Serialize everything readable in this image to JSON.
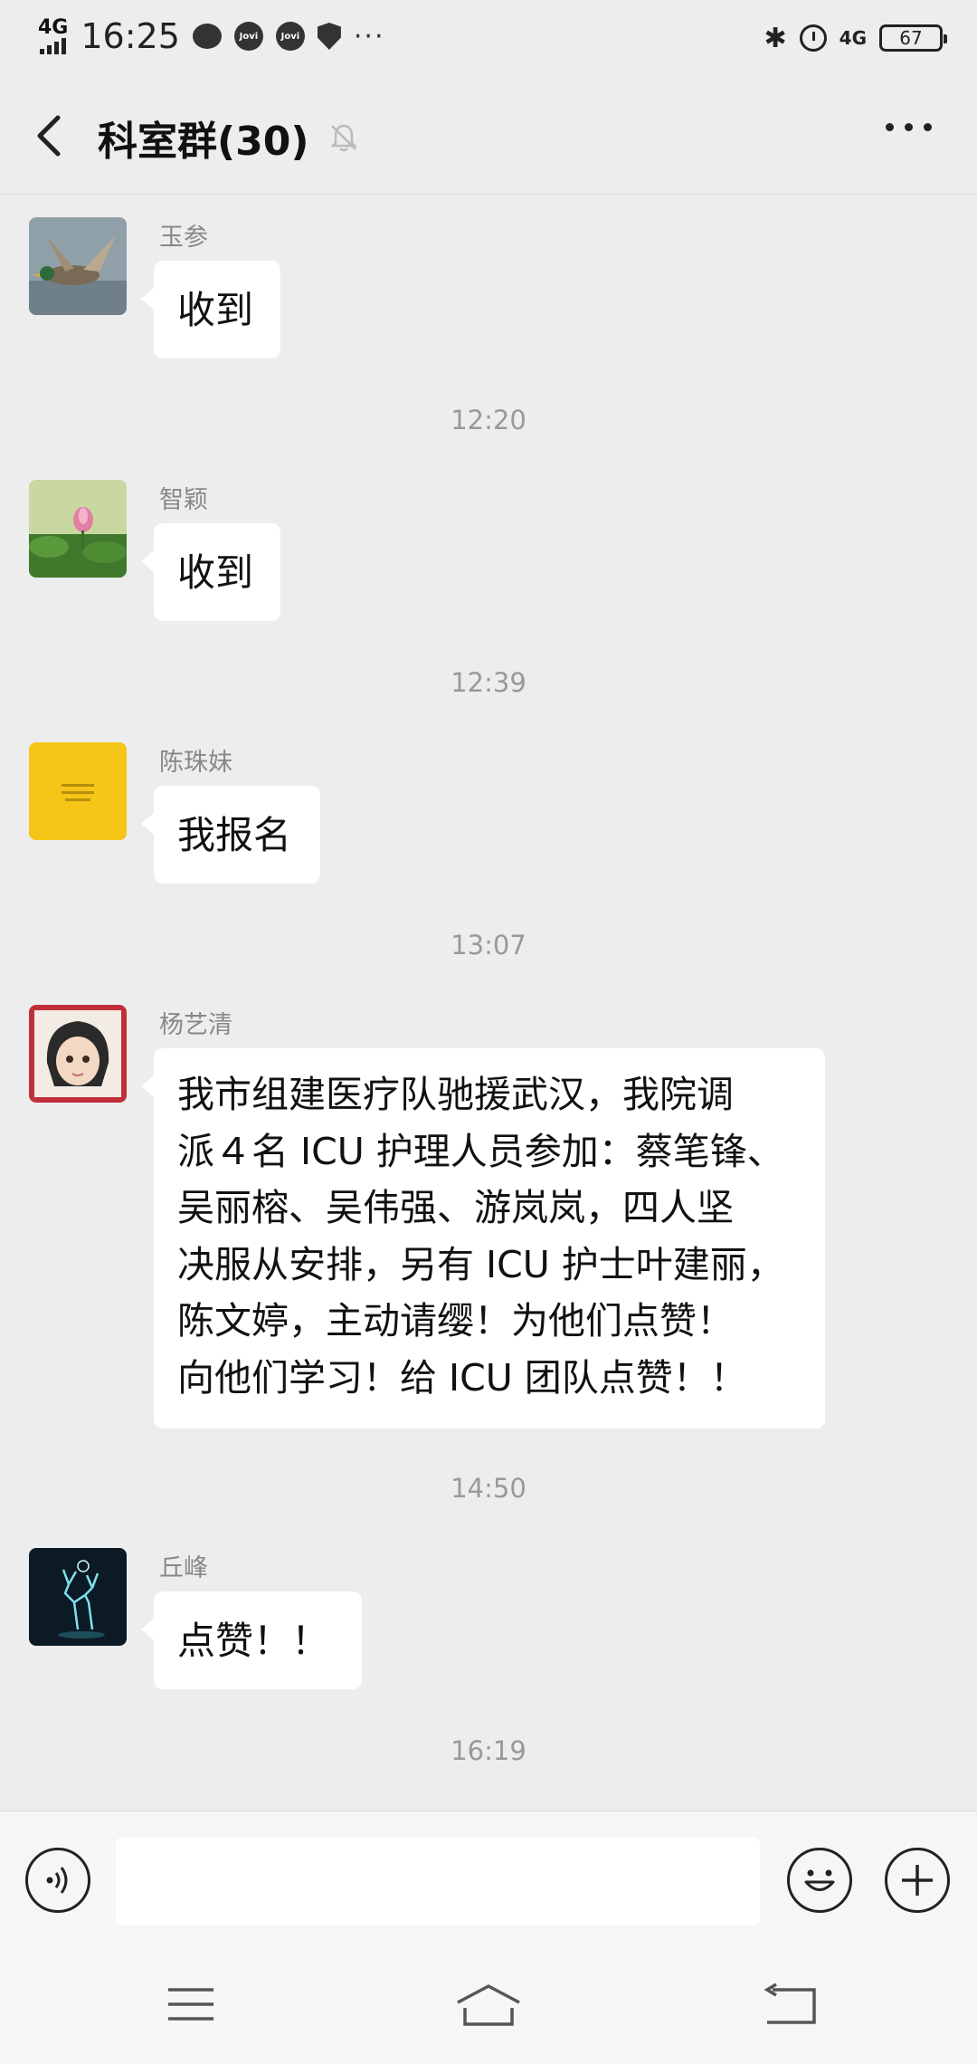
{
  "status_bar": {
    "network_left": "4G",
    "time": "16:25",
    "notif_label_1": "Jovi",
    "notif_label_2": "Jovi",
    "more_notifs": "···",
    "network_right": "4G",
    "battery": "67"
  },
  "header": {
    "title": "科室群(30)"
  },
  "messages": [
    {
      "sender": "玉参",
      "text": "收到"
    },
    {
      "sender": "智颖",
      "text": "收到"
    },
    {
      "sender": "陈珠妹",
      "text": "我报名"
    },
    {
      "sender": "杨艺清",
      "lines": [
        "我市组建医疗队驰援武汉，我院调",
        "派４名 ICU 护理人员参加：蔡笔锋、",
        "吴丽榕、吴伟强、游岚岚，四人坚",
        "决服从安排，另有 ICU 护士叶建丽，",
        "陈文婷，主动请缨！为他们点赞！",
        "向他们学习！给 ICU 团队点赞！！"
      ]
    },
    {
      "sender": "丘峰",
      "text": "点赞！！"
    }
  ],
  "timestamps": [
    "12:20",
    "12:39",
    "13:07",
    "14:50",
    "16:19"
  ],
  "input": {
    "placeholder": ""
  },
  "colors": {
    "background": "#ededed",
    "bubble": "#ffffff",
    "timestamp": "#999999"
  }
}
